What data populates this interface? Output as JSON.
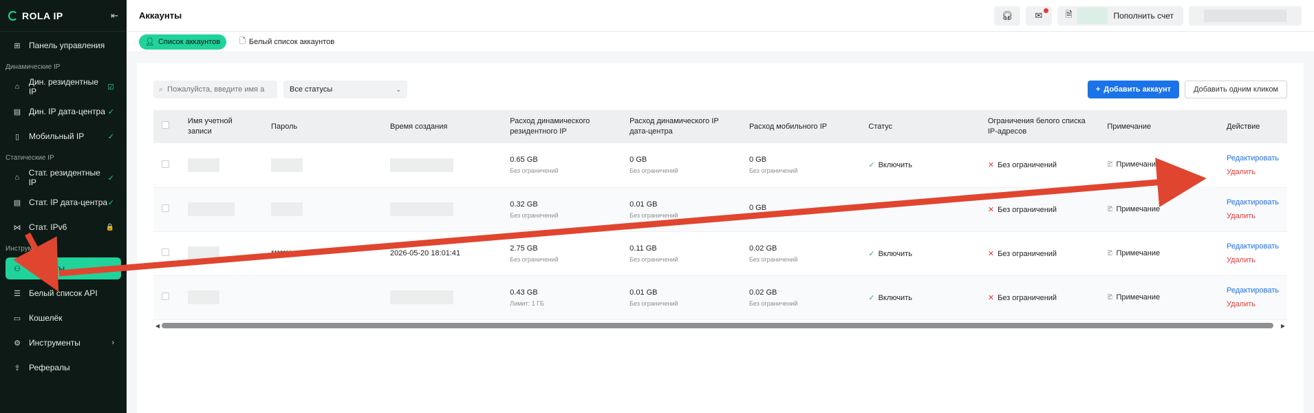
{
  "app": {
    "brand": "ROLA IP"
  },
  "sidebar": {
    "items": [
      {
        "label": "Панель управления",
        "icon": "dashboard-icon"
      },
      {
        "section": "Динамические IP"
      },
      {
        "label": "Дин. резидентные IP",
        "icon": "home-icon",
        "badge": "☑"
      },
      {
        "label": "Дин. IP дата-центра",
        "icon": "server-icon",
        "badge": "✓"
      },
      {
        "label": "Мобильный IP",
        "icon": "mobile-icon",
        "badge": "✓"
      },
      {
        "section": "Статические IP"
      },
      {
        "label": "Стат. резидентные IP",
        "icon": "home-icon",
        "badge": "✓"
      },
      {
        "label": "Стат. IP дата-центра",
        "icon": "server-icon",
        "badge": "✓"
      },
      {
        "label": "Стат. IPv6",
        "icon": "network-icon",
        "badge": "🔒"
      },
      {
        "section": "Инструменты"
      },
      {
        "label": "Аккаунты",
        "icon": "users-icon",
        "active": true
      },
      {
        "label": "Белый список API",
        "icon": "list-icon"
      },
      {
        "label": "Кошелёк",
        "icon": "wallet-icon"
      },
      {
        "label": "Инструменты",
        "icon": "tools-icon",
        "chevron": "›"
      },
      {
        "label": "Рефералы",
        "icon": "share-icon"
      }
    ]
  },
  "header": {
    "title": "Аккаунты",
    "topup_label": "Пополнить счет"
  },
  "tabs": [
    {
      "label": "Список аккаунтов",
      "active": true
    },
    {
      "label": "Белый список аккаунтов",
      "active": false
    }
  ],
  "filters": {
    "search_placeholder": "Пожалуйста, введите имя а",
    "status_value": "Все статусы",
    "add_button": "Добавить аккаунт",
    "oneclick_button": "Добавить одним кликом"
  },
  "table": {
    "columns": [
      "Имя учетной записи",
      "Пароль",
      "Время создания",
      "Расход динамического резидентного IP",
      "Расход динамического IP дата-центра",
      "Расход мобильного IP",
      "Статус",
      "Ограничения белого списка IP-адресов",
      "Примечание",
      "Действие"
    ],
    "rows": [
      {
        "password": "",
        "created": "",
        "res": "0.65 GB",
        "res_sub": "Без ограничений",
        "dc": "0 GB",
        "dc_sub": "Без ограничений",
        "mob": "0 GB",
        "mob_sub": "Без ограничений",
        "status": "Включить",
        "whitelist": "Без ограничений",
        "note": "Примечание",
        "edit": "Редактировать",
        "del": "Удалить"
      },
      {
        "password": "",
        "created": "",
        "res": "0.32 GB",
        "res_sub": "Без ограничений",
        "dc": "0.01 GB",
        "dc_sub": "Без ограничений",
        "mob": "0 GB",
        "mob_sub": "",
        "status": "",
        "whitelist": "Без ограничений",
        "note": "Примечание",
        "edit": "Редактировать",
        "del": "Удалить"
      },
      {
        "password": "*******",
        "created": "2026-05-20 18:01:41",
        "res": "2.75 GB",
        "res_sub": "Без ограничений",
        "dc": "0.11 GB",
        "dc_sub": "Без ограничений",
        "mob": "0.02 GB",
        "mob_sub": "Без ограничений",
        "status": "Включить",
        "whitelist": "Без ограничений",
        "note": "Примечание",
        "edit": "Редактировать",
        "del": "Удалить"
      },
      {
        "password": "",
        "created": "",
        "res": "0.43 GB",
        "res_sub": "Лимит: 1 ГБ",
        "dc": "0.01 GB",
        "dc_sub": "Без ограничений",
        "mob": "0.02 GB",
        "mob_sub": "Без ограничений",
        "status": "Включить",
        "whitelist": "Без ограничений",
        "note": "Примечание",
        "edit": "Редактировать",
        "del": "Удалить"
      }
    ]
  },
  "scrollbar": {
    "position": 0.0,
    "visible_fraction": 0.995
  },
  "colors": {
    "accent": "#1fd39a",
    "sidebar_bg": "#0d1a16",
    "primary": "#1a73e8",
    "danger": "#e53935",
    "annotation_arrow": "#e0452f"
  }
}
